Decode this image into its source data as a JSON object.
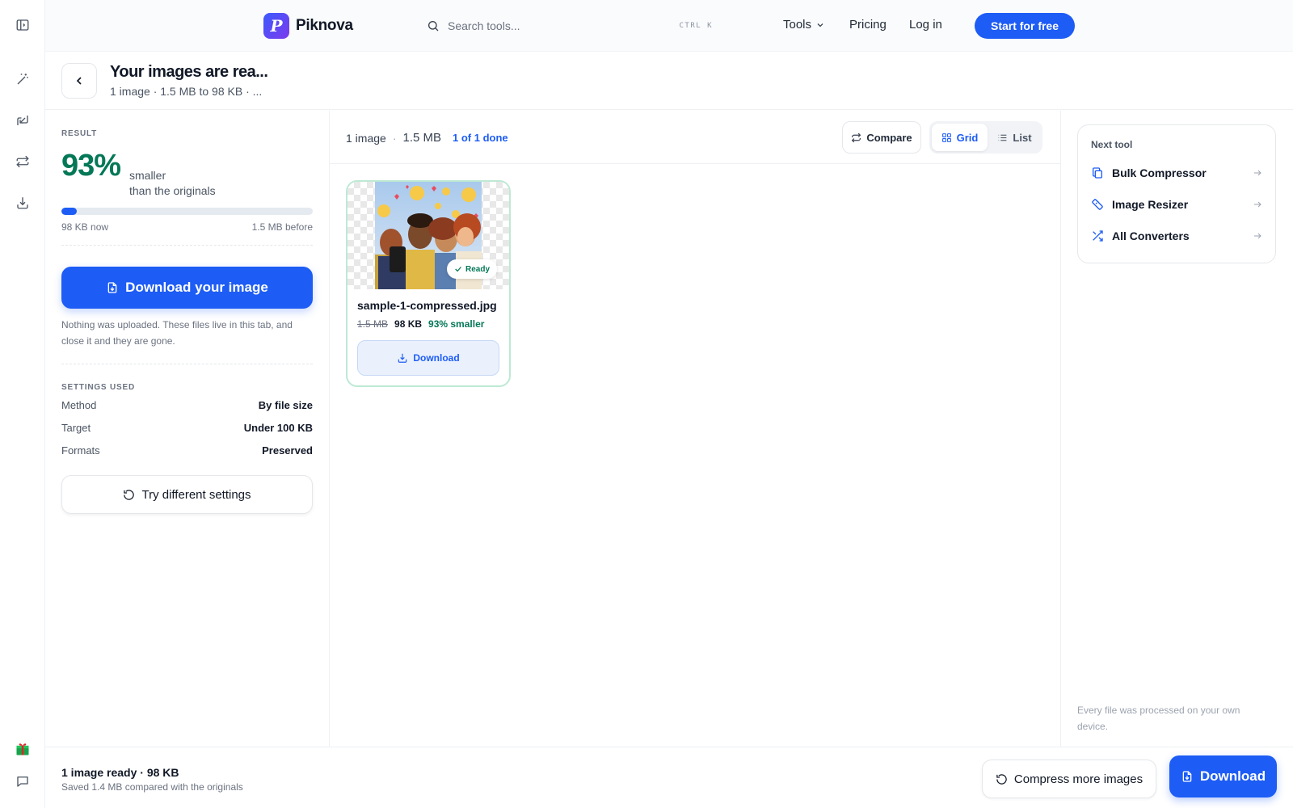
{
  "brand": {
    "name": "Piknova",
    "logo_letter": "P"
  },
  "search": {
    "placeholder": "Search tools...",
    "shortcut": "CTRL  K"
  },
  "nav": {
    "tools": "Tools",
    "pricing": "Pricing",
    "login": "Log in",
    "start": "Start for free"
  },
  "page": {
    "title": "Your images are rea...",
    "subtitle": "1 image · 1.5 MB to 98 KB · ..."
  },
  "result": {
    "caption": "RESULT",
    "percent": "93%",
    "smaller_line1": "smaller",
    "smaller_line2": "than the originals",
    "progress_fraction": 0.06,
    "now_label": "98 KB now",
    "before_label": "1.5 MB before",
    "download_label": "Download your image",
    "privacy_note": "Nothing was uploaded. These files live in this tab, and close it and they are gone."
  },
  "settings": {
    "caption": "SETTINGS USED",
    "rows": [
      {
        "key": "Method",
        "value": "By file size"
      },
      {
        "key": "Target",
        "value": "Under 100 KB"
      },
      {
        "key": "Formats",
        "value": "Preserved"
      }
    ],
    "try_label": "Try different settings"
  },
  "toolbar": {
    "count": "1 image",
    "size": "1.5 MB",
    "done": "1 of 1 done",
    "compare": "Compare",
    "grid": "Grid",
    "list": "List"
  },
  "file": {
    "name": "sample-1-compressed.jpg",
    "old_size": "1.5 MB",
    "new_size": "98 KB",
    "saved": "93% smaller",
    "status": "Ready",
    "download": "Download"
  },
  "next_tool": {
    "title": "Next tool",
    "items": [
      {
        "label": "Bulk Compressor",
        "icon": "copy-icon"
      },
      {
        "label": "Image Resizer",
        "icon": "ruler-icon"
      },
      {
        "label": "All Converters",
        "icon": "shuffle-icon"
      }
    ],
    "device_note": "Every file was processed on your own device."
  },
  "bottom": {
    "title": "1 image ready · 98 KB",
    "subtitle": "Saved 1.4 MB compared with the originals",
    "more": "Compress more images",
    "download": "Download"
  },
  "colors": {
    "accent": "#1d5cf5",
    "success": "#047857",
    "ready_border": "#bde9d4"
  }
}
